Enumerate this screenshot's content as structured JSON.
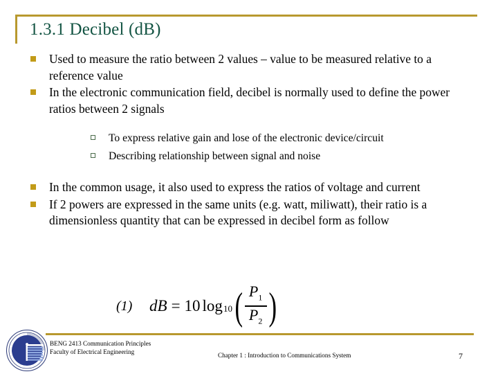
{
  "slide": {
    "title": "1.3.1 Decibel (dB)",
    "accent_gold": "#b8992e",
    "title_green": "#135443",
    "bullet_gold": "#c29b18",
    "subbullet_green": "#4a6b4a"
  },
  "bullets": [
    {
      "marker": "filled-square-bullet",
      "text": "Used to measure the ratio between 2 values – value to be measured relative to a reference value"
    },
    {
      "marker": "filled-square-bullet",
      "text": "In the electronic communication field, decibel is normally used to define the power ratios between 2 signals"
    },
    {
      "marker": "filled-square-bullet",
      "text": "In the common usage, it also used to express the ratios of voltage and current"
    },
    {
      "marker": "filled-square-bullet",
      "text": "If  2  powers are expressed in the same units (e.g. watt, miliwatt), their ratio is a dimensionless quantity that can be expressed in decibel form as follow"
    }
  ],
  "sub_bullets": [
    {
      "marker": "hollow-square-bullet",
      "text": "To express relative gain and lose of the electronic device/circuit"
    },
    {
      "marker": "hollow-square-bullet",
      "text": "Describing relationship between signal and noise"
    }
  ],
  "equation": {
    "number": "(1)",
    "lhs": "dB",
    "equals": "=",
    "coefficient": "10",
    "log": "log",
    "log_base": "10",
    "paren_open": "(",
    "paren_close": ")",
    "numerator": "P",
    "numerator_sub": "1",
    "denominator": "P",
    "denominator_sub": "2",
    "plain_text": "dB = 10 log10 ( P1 / P2 )"
  },
  "footer": {
    "course": "BENG 2413 Communication Principles",
    "faculty": "Faculty of Electrical Engineering",
    "chapter": "Chapter 1 : Introduction to Communications System",
    "page_number": "7",
    "logo_name": "universiti-teknikal-malaysia-melaka-logo"
  }
}
